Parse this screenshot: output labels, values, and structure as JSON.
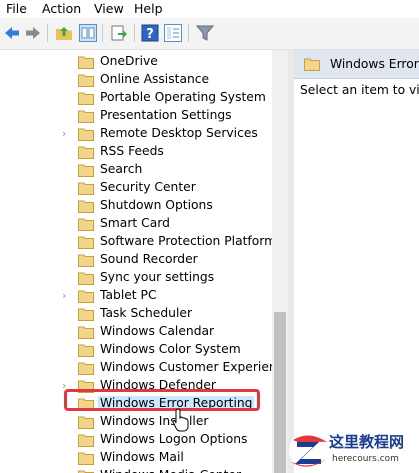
{
  "menu": [
    "File",
    "Action",
    "View",
    "Help"
  ],
  "tree_items": [
    {
      "label": "OneDrive",
      "expandable": false
    },
    {
      "label": "Online Assistance",
      "expandable": false
    },
    {
      "label": "Portable Operating System",
      "expandable": false
    },
    {
      "label": "Presentation Settings",
      "expandable": false
    },
    {
      "label": "Remote Desktop Services",
      "expandable": true
    },
    {
      "label": "RSS Feeds",
      "expandable": false
    },
    {
      "label": "Search",
      "expandable": false
    },
    {
      "label": "Security Center",
      "expandable": false
    },
    {
      "label": "Shutdown Options",
      "expandable": false
    },
    {
      "label": "Smart Card",
      "expandable": false
    },
    {
      "label": "Software Protection Platform",
      "expandable": false
    },
    {
      "label": "Sound Recorder",
      "expandable": false
    },
    {
      "label": "Sync your settings",
      "expandable": false
    },
    {
      "label": "Tablet PC",
      "expandable": true
    },
    {
      "label": "Task Scheduler",
      "expandable": false
    },
    {
      "label": "Windows Calendar",
      "expandable": false
    },
    {
      "label": "Windows Color System",
      "expandable": false
    },
    {
      "label": "Windows Customer Experience Improvement Program",
      "expandable": false
    },
    {
      "label": "Windows Defender",
      "expandable": true
    },
    {
      "label": "Windows Error Reporting",
      "expandable": false,
      "selected": true
    },
    {
      "label": "Windows Installer",
      "expandable": false
    },
    {
      "label": "Windows Logon Options",
      "expandable": false
    },
    {
      "label": "Windows Mail",
      "expandable": false
    },
    {
      "label": "Windows Media Center",
      "expandable": false
    }
  ],
  "right_pane": {
    "title": "Windows Error Reporting",
    "hint": "Select an item to view its description."
  },
  "watermark": {
    "text": "这里教程网",
    "url": "herecours.com"
  },
  "colors": {
    "folder": "#e8c15a",
    "highlight_border": "#e0383e",
    "selection": "#cce8ff"
  }
}
